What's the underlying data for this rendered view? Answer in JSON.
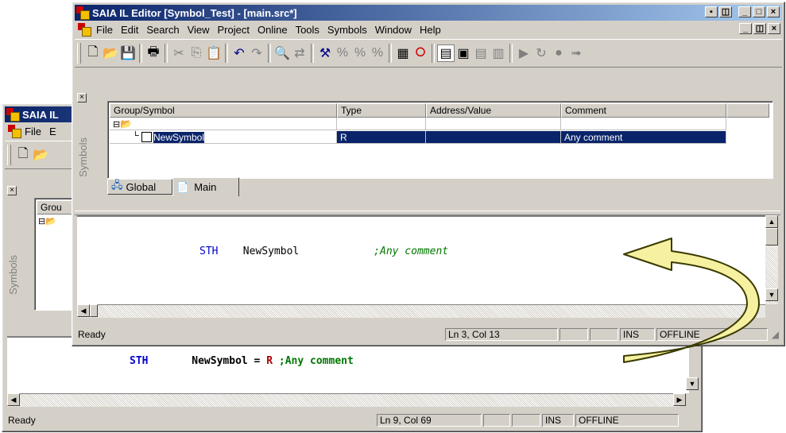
{
  "colors": {
    "keyword": "#0000cc",
    "comment": "#007700",
    "type_r": "#aa0000",
    "title_from": "#0a246a",
    "title_to": "#a6caf0",
    "arrow_fill": "#f5f1a0",
    "arrow_stroke": "#3a3a00"
  },
  "back_window": {
    "title": "SAIA IL",
    "menu": [
      "File",
      "E"
    ],
    "symbols_tab": "Symbols",
    "grid_header": "Grou",
    "code": {
      "keyword": "STH",
      "symbol": "NewSymbol",
      "op": " = ",
      "type": "R",
      "comment": " ;Any comment"
    },
    "status": {
      "ready": "Ready",
      "pos": "Ln 9, Col 69",
      "ins": "INS",
      "mode": "OFFLINE"
    }
  },
  "front_window": {
    "title": "SAIA IL Editor [Symbol_Test] - [main.src*]",
    "menu": [
      "File",
      "Edit",
      "Search",
      "View",
      "Project",
      "Online",
      "Tools",
      "Symbols",
      "Window",
      "Help"
    ],
    "symbols_tab": "Symbols",
    "columns": [
      "Group/Symbol",
      "Type",
      "Address/Value",
      "Comment"
    ],
    "rows": [
      {
        "symbol": "",
        "type": "",
        "address": "",
        "comment": "",
        "folder": true
      },
      {
        "symbol": "NewSymbol",
        "type": "R",
        "address": "",
        "comment": "Any comment",
        "selected": true
      }
    ],
    "tabs": [
      "Global",
      "Main"
    ],
    "code": {
      "keyword": "STH",
      "symbol": "NewSymbol",
      "comment": ";Any comment"
    },
    "status": {
      "ready": "Ready",
      "pos": "Ln 3, Col 13",
      "ins": "INS",
      "mode": "OFFLINE"
    }
  }
}
